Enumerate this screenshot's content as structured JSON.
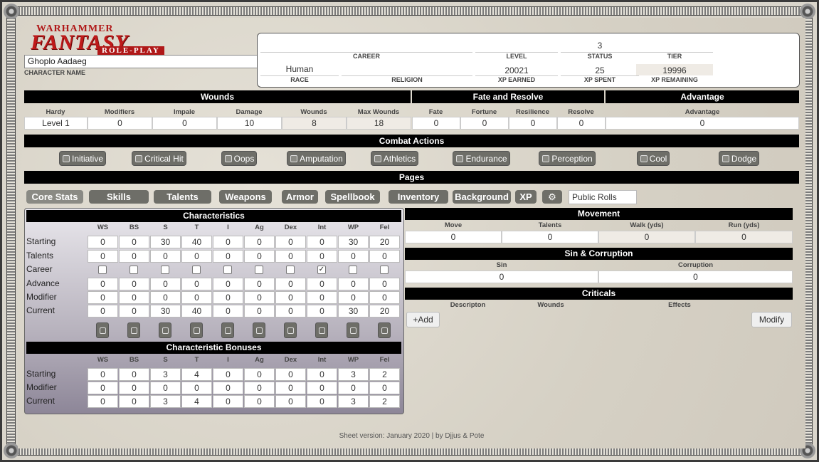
{
  "logo": {
    "line1": "WARHAMMER",
    "line2": "FANTASY",
    "line3": "ROLE-PLAY"
  },
  "character": {
    "name": "Ghoplo Aadaeg",
    "name_label": "CHARACTER NAME"
  },
  "info": {
    "career_label": "CAREER",
    "level_label": "LEVEL",
    "status_label": "STATUS",
    "tier_label": "TIER",
    "career": "",
    "level": "",
    "status": "3",
    "tier": "",
    "race_label": "RACE",
    "religion_label": "RELIGION",
    "xp_earned_label": "XP EARNED",
    "xp_spent_label": "XP SPENT",
    "xp_remaining_label": "XP REMAINING",
    "race": "Human",
    "religion": "",
    "xp_earned": "20021",
    "xp_spent": "25",
    "xp_remaining": "19996"
  },
  "wounds": {
    "title": "Wounds",
    "headers": [
      "Hardy",
      "Modifiers",
      "Impale",
      "Damage",
      "Wounds",
      "Max Wounds"
    ],
    "values": [
      "Level 1",
      "0",
      "0",
      "10",
      "8",
      "18"
    ]
  },
  "fate": {
    "title": "Fate and Resolve",
    "headers": [
      "Fate",
      "Fortune",
      "Resilience",
      "Resolve"
    ],
    "values": [
      "0",
      "0",
      "0",
      "0"
    ]
  },
  "advantage": {
    "title": "Advantage",
    "header": "Advantage",
    "value": "0"
  },
  "combat": {
    "title": "Combat Actions",
    "buttons": [
      "Initiative",
      "Critical Hit",
      "Oops",
      "Amputation",
      "Athletics",
      "Endurance",
      "Perception",
      "Cool",
      "Dodge"
    ]
  },
  "pages": {
    "title": "Pages",
    "tabs": [
      "Core Stats",
      "Skills",
      "Talents",
      "Weapons",
      "Armor",
      "Spellbook",
      "Inventory",
      "Background",
      "XP"
    ],
    "public_rolls": "Public Rolls"
  },
  "characteristics": {
    "title": "Characteristics",
    "columns": [
      "WS",
      "BS",
      "S",
      "T",
      "I",
      "Ag",
      "Dex",
      "Int",
      "WP",
      "Fel"
    ],
    "rows": [
      {
        "label": "Starting",
        "values": [
          "0",
          "0",
          "30",
          "40",
          "0",
          "0",
          "0",
          "0",
          "30",
          "20"
        ]
      },
      {
        "label": "Talents",
        "values": [
          "0",
          "0",
          "0",
          "0",
          "0",
          "0",
          "0",
          "0",
          "0",
          "0"
        ]
      },
      {
        "label": "Career",
        "checked": [
          false,
          false,
          false,
          false,
          false,
          false,
          false,
          true,
          false,
          false
        ]
      },
      {
        "label": "Advance",
        "values": [
          "0",
          "0",
          "0",
          "0",
          "0",
          "0",
          "0",
          "0",
          "0",
          "0"
        ]
      },
      {
        "label": "Modifier",
        "values": [
          "0",
          "0",
          "0",
          "0",
          "0",
          "0",
          "0",
          "0",
          "0",
          "0"
        ]
      },
      {
        "label": "Current",
        "values": [
          "0",
          "0",
          "30",
          "40",
          "0",
          "0",
          "0",
          "0",
          "30",
          "20"
        ]
      }
    ]
  },
  "bonuses": {
    "title": "Characteristic Bonuses",
    "columns": [
      "WS",
      "BS",
      "S",
      "T",
      "I",
      "Ag",
      "Dex",
      "Int",
      "WP",
      "Fel"
    ],
    "rows": [
      {
        "label": "Starting",
        "values": [
          "0",
          "0",
          "3",
          "4",
          "0",
          "0",
          "0",
          "0",
          "3",
          "2"
        ]
      },
      {
        "label": "Modifier",
        "values": [
          "0",
          "0",
          "0",
          "0",
          "0",
          "0",
          "0",
          "0",
          "0",
          "0"
        ]
      },
      {
        "label": "Current",
        "values": [
          "0",
          "0",
          "3",
          "4",
          "0",
          "0",
          "0",
          "0",
          "3",
          "2"
        ]
      }
    ]
  },
  "movement": {
    "title": "Movement",
    "headers": [
      "Move",
      "Talents",
      "Walk (yds)",
      "Run (yds)"
    ],
    "values": [
      "0",
      "0",
      "0",
      "0"
    ]
  },
  "sin": {
    "title": "Sin & Corruption",
    "headers": [
      "Sin",
      "Corruption"
    ],
    "values": [
      "0",
      "0"
    ]
  },
  "criticals": {
    "title": "Criticals",
    "headers": [
      "Descripton",
      "Wounds",
      "Effects"
    ],
    "add_label": "+Add",
    "modify_label": "Modify"
  },
  "footer": "Sheet version: January 2020 | by Djjus & Pote"
}
